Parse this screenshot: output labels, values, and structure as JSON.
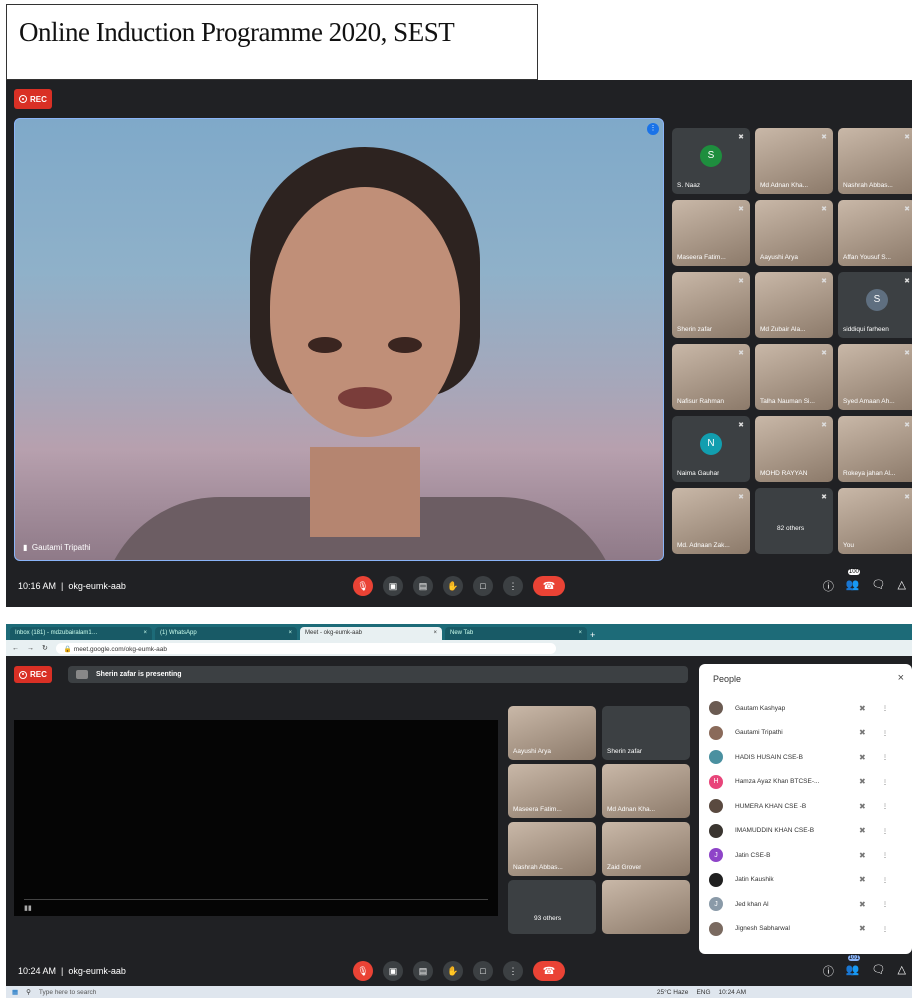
{
  "caption": "Online Induction Programme 2020, SEST",
  "top": {
    "rec": "REC",
    "main_speaker": "Gautami Tripathi",
    "time": "10:16 AM",
    "meeting_code": "okg-eumk-aab",
    "participants_badge": "100",
    "tiles": [
      {
        "name": "S. Naaz",
        "initial": "S",
        "color": "#1e8e3e"
      },
      {
        "name": "Md Adnan Kha...",
        "initial": "",
        "color": ""
      },
      {
        "name": "Nashrah Abbas...",
        "initial": "",
        "color": ""
      },
      {
        "name": "Maseera Fatim...",
        "initial": "",
        "color": ""
      },
      {
        "name": "Aayushi Arya",
        "initial": "",
        "color": ""
      },
      {
        "name": "Affan Yousuf S...",
        "initial": "",
        "color": ""
      },
      {
        "name": "Sherin zafar",
        "initial": "",
        "color": ""
      },
      {
        "name": "Md Zubair Ala...",
        "initial": "",
        "color": ""
      },
      {
        "name": "siddiqui farheen",
        "initial": "S",
        "color": "#5f6f80"
      },
      {
        "name": "Nafisur Rahman",
        "initial": "",
        "color": ""
      },
      {
        "name": "Talha Nauman Si...",
        "initial": "",
        "color": ""
      },
      {
        "name": "Syed Amaan Ah...",
        "initial": "",
        "color": ""
      },
      {
        "name": "Naima Gauhar",
        "initial": "N",
        "color": "#129eaf"
      },
      {
        "name": "MOHD RAYYAN",
        "initial": "",
        "color": ""
      },
      {
        "name": "Rokeya jahan Al...",
        "initial": "",
        "color": ""
      },
      {
        "name": "Md. Adnaan Zak...",
        "initial": "",
        "color": ""
      },
      {
        "name": "82 others",
        "initial": "",
        "color": ""
      },
      {
        "name": "You",
        "initial": "",
        "color": ""
      }
    ]
  },
  "bottom": {
    "tabs": [
      "Inbox (181) - mdzubairalam1…",
      "(1) WhatsApp",
      "Meet - okg-eumk-aab",
      "New Tab"
    ],
    "url": "meet.google.com/okg-eumk-aab",
    "rec": "REC",
    "presenting": "Sherin zafar is presenting",
    "time": "10:24 AM",
    "meeting_code": "okg-eumk-aab",
    "participants_badge": "101",
    "tiles": [
      {
        "name": "Aayushi Arya"
      },
      {
        "name": "Sherin zafar"
      },
      {
        "name": "Maseera Fatim..."
      },
      {
        "name": "Md Adnan Kha..."
      },
      {
        "name": "Nashrah Abbas..."
      },
      {
        "name": "Zaid Grover"
      },
      {
        "name": "93 others"
      },
      {
        "name": ""
      }
    ],
    "people_title": "People",
    "people": [
      {
        "name": "Gautam Kashyap",
        "initial": "",
        "color": "#6b5b52"
      },
      {
        "name": "Gautami Tripathi",
        "initial": "",
        "color": "#8a6a5a"
      },
      {
        "name": "HADIS HUSAIN CSE-B",
        "initial": "",
        "color": "#4a90a0"
      },
      {
        "name": "Hamza Ayaz Khan BTCSE-...",
        "initial": "H",
        "color": "#e8457a"
      },
      {
        "name": "HUMERA KHAN CSE -B",
        "initial": "",
        "color": "#5a4a40"
      },
      {
        "name": "IMAMUDDIN KHAN CSE-B",
        "initial": "",
        "color": "#3a3530"
      },
      {
        "name": "Jatin CSE-B",
        "initial": "J",
        "color": "#8e44c8"
      },
      {
        "name": "Jatin Kaushik",
        "initial": "",
        "color": "#202020"
      },
      {
        "name": "Jed khan Al",
        "initial": "J",
        "color": "#8a9aa8"
      },
      {
        "name": "Jignesh Sabharwal",
        "initial": "",
        "color": "#7a6a60"
      }
    ],
    "taskbar": {
      "search": "Type here to search",
      "weather": "25°C Haze",
      "lang": "ENG",
      "time": "10:24 AM"
    }
  }
}
